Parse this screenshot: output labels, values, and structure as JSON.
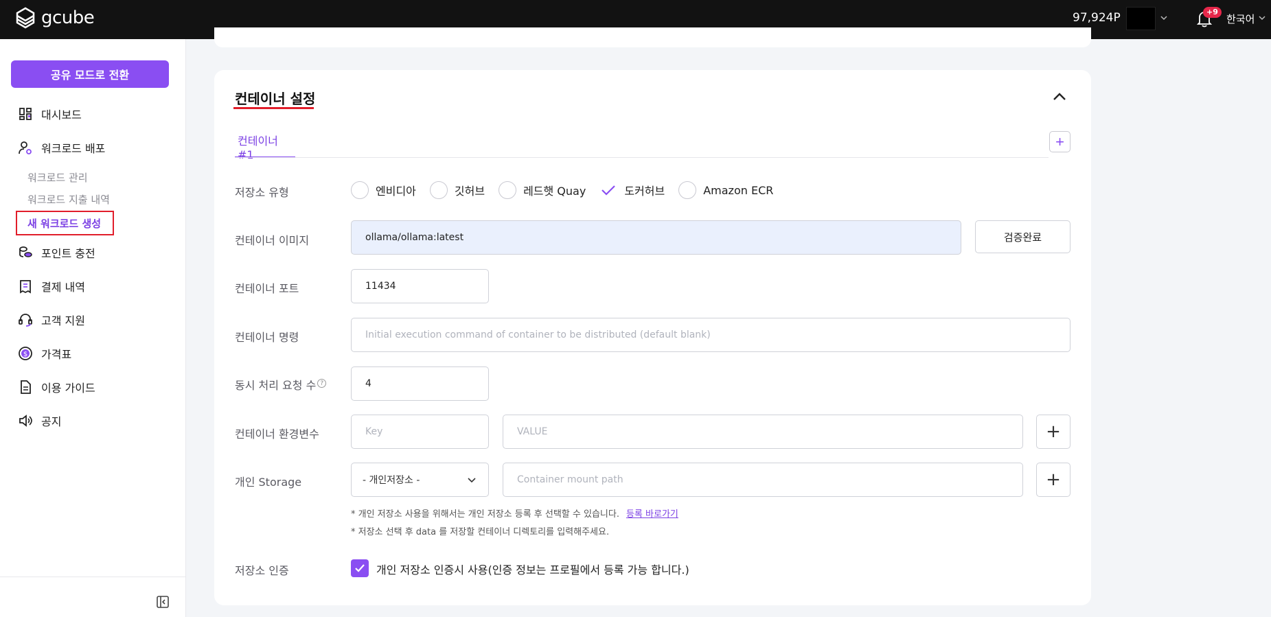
{
  "header": {
    "logo_text": "gcube",
    "points": "97,924P",
    "notification_badge": "+9",
    "language": "한국어"
  },
  "sidebar": {
    "share_mode_button": "공유 모드로 전환",
    "items": [
      {
        "label": "대시보드",
        "icon": "dashboard-icon"
      },
      {
        "label": "워크로드 배포",
        "icon": "user-gear-icon"
      },
      {
        "label": "포인트 충전",
        "icon": "coins-icon"
      },
      {
        "label": "결제 내역",
        "icon": "receipt-icon"
      },
      {
        "label": "고객 지원",
        "icon": "headset-icon"
      },
      {
        "label": "가격표",
        "icon": "dollar-icon"
      },
      {
        "label": "이용 가이드",
        "icon": "document-icon"
      },
      {
        "label": "공지",
        "icon": "speaker-icon"
      }
    ],
    "sub_items": [
      "워크로드 관리",
      "워크로드 지출 내역",
      "새 워크로드 생성"
    ]
  },
  "section": {
    "title": "컨테이너 설정",
    "tab_label": "컨테이너 #1"
  },
  "form": {
    "registry_label": "저장소 유형",
    "registry_options": [
      "엔비디아",
      "깃허브",
      "레드햇 Quay",
      "도커허브",
      "Amazon ECR"
    ],
    "registry_selected": "도커허브",
    "image_label": "컨테이너 이미지",
    "image_value": "ollama/ollama:latest",
    "verify_button": "검증완료",
    "port_label": "컨테이너 포트",
    "port_value": "11434",
    "command_label": "컨테이너 명령",
    "command_placeholder": "Initial execution command of container to be distributed (default blank)",
    "concurrency_label": "동시 처리 요청 수",
    "concurrency_help": "?",
    "concurrency_value": "4",
    "env_label": "컨테이너 환경변수",
    "env_key_placeholder": "Key",
    "env_value_placeholder": "VALUE",
    "storage_label": "개인 Storage",
    "storage_select": "- 개인저장소 -",
    "storage_mount_placeholder": "Container mount path",
    "note1": "* 개인 저장소 사용을 위해서는 개인 저장소 등록 후 선택할 수 있습니다.",
    "note1_link": "등록 바로가기",
    "note2": "* 저장소 선택 후 data 를 저장할 컨테이너 디렉토리를 입력해주세요.",
    "auth_label": "저장소 인증",
    "auth_checkbox_label": "개인 저장소 인증시 사용(인증 정보는 프로필에서 등록 가능 합니다.)"
  },
  "colors": {
    "accent": "#8a4ef2",
    "highlight_border": "#e11d2a",
    "header_bg": "#121212"
  }
}
